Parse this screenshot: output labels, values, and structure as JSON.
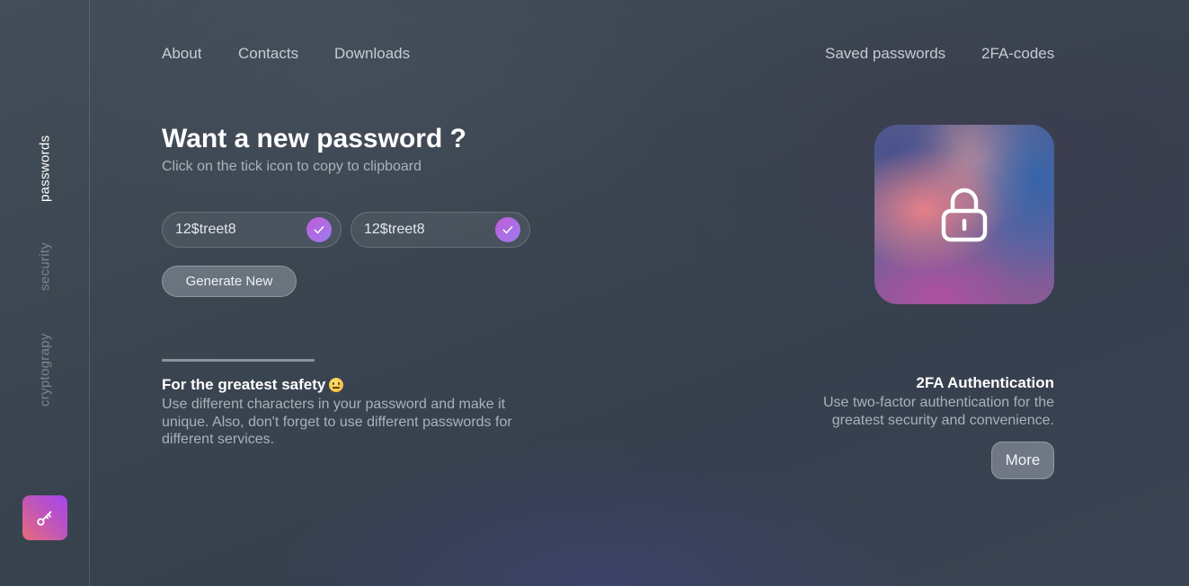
{
  "sidebar": {
    "items": [
      {
        "label": "passwords",
        "active": true
      },
      {
        "label": "security",
        "active": false
      },
      {
        "label": "cryptograpy",
        "active": false
      }
    ],
    "logo_icon": "key-icon"
  },
  "nav": {
    "left": [
      "About",
      "Contacts",
      "Downloads"
    ],
    "right": [
      "Saved passwords",
      "2FA-codes"
    ]
  },
  "hero": {
    "title": "Want a new password ?",
    "subtitle": "Click on the tick icon to copy to clipboard"
  },
  "passwords": [
    {
      "value": "12$treet8",
      "icon": "check-icon"
    },
    {
      "value": "12$treet8",
      "icon": "check-icon"
    }
  ],
  "generate_label": "Generate New",
  "safety": {
    "title": "For the greatest safety",
    "emoji": "grimacing-face",
    "text": "Use different characters in your password and make it unique. Also, don't forget to use different passwords for different services."
  },
  "twofa": {
    "card_icon": "lock-icon",
    "title": "2FA Authentication",
    "text": "Use two-factor authentication for the greatest security and convenience.",
    "more_label": "More"
  },
  "colors": {
    "accent_gradient": [
      "#e86c78",
      "#a644ee"
    ],
    "tick_gradient": [
      "#c05cd8",
      "#9c7cf0"
    ],
    "inactive_text": "#7b858f"
  }
}
